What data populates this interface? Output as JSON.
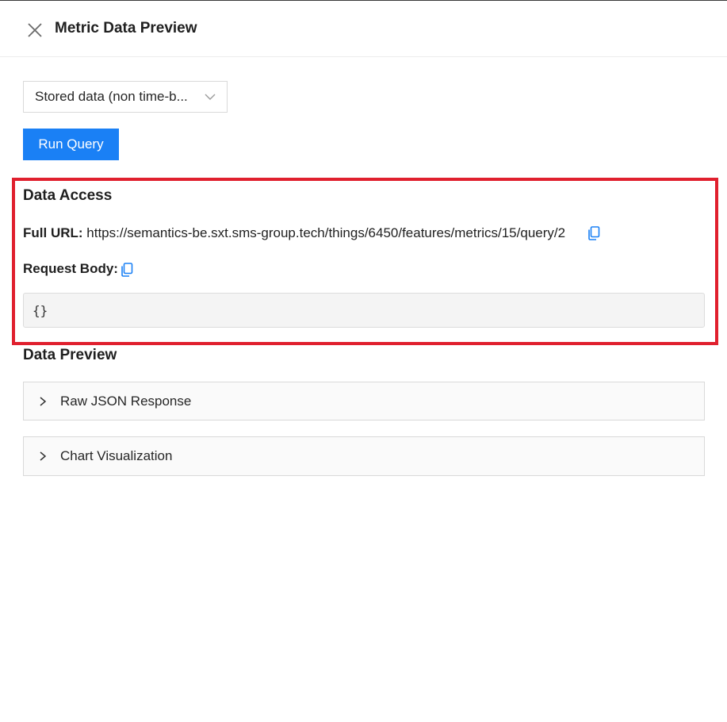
{
  "header": {
    "title": "Metric Data Preview",
    "close_icon": "close-icon"
  },
  "controls": {
    "data_type_select": "Stored data (non time-b...",
    "run_query_label": "Run Query"
  },
  "data_access": {
    "title": "Data Access",
    "full_url_label": "Full URL:",
    "full_url_value": "https://semantics-be.sxt.sms-group.tech/things/6450/features/metrics/15/query/2",
    "request_body_label": "Request Body:",
    "request_body_value": "{}"
  },
  "data_preview": {
    "title": "Data Preview",
    "panels": [
      {
        "label": "Raw JSON Response"
      },
      {
        "label": "Chart Visualization"
      }
    ]
  },
  "colors": {
    "accent": "#1a80f5",
    "highlight": "#e0202e",
    "copy_icon": "#1a80f5"
  }
}
